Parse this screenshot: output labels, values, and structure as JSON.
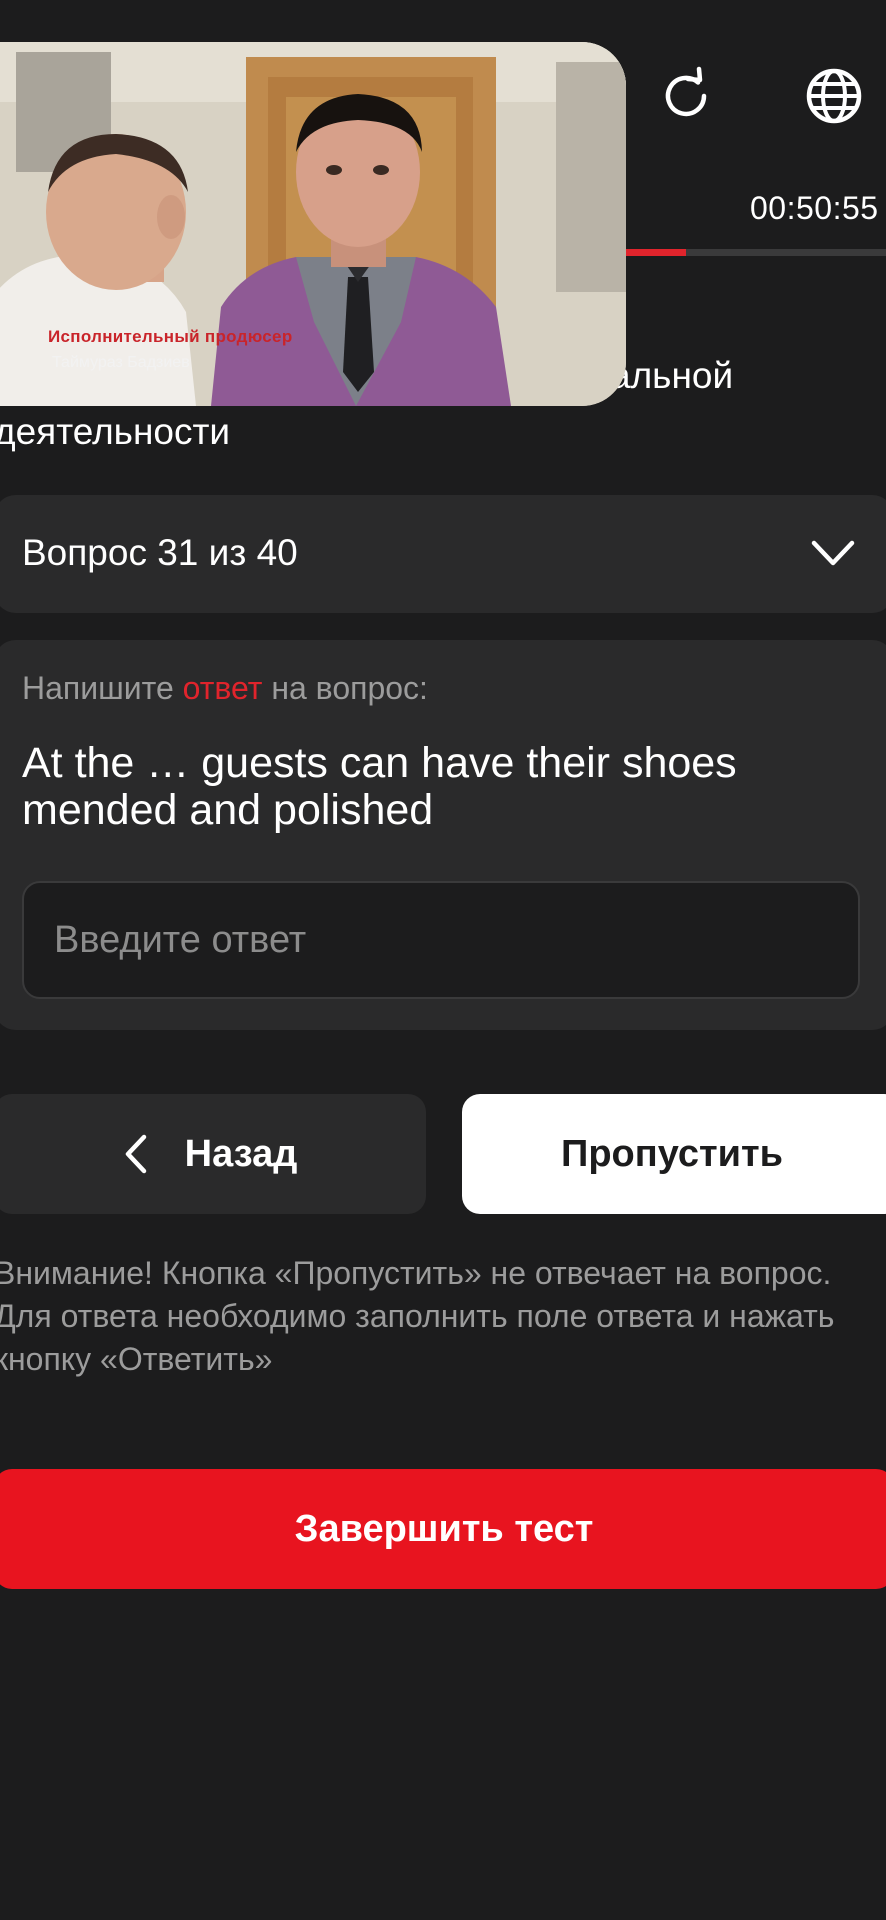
{
  "header": {
    "refresh_icon": "refresh-icon",
    "globe_icon": "globe-icon",
    "timer": "00:50:55",
    "progress_fraction": 0.774
  },
  "subject": {
    "title_line1": "альной",
    "title_line2": "деятельности"
  },
  "video": {
    "caption_role": "Исполнительный продюсер",
    "caption_name": "Таймураз Бадзиев"
  },
  "question_selector": {
    "label": "Вопрос 31 из 40",
    "chevron_icon": "chevron-down-icon"
  },
  "question": {
    "prompt_before": "Напишите ",
    "prompt_accent": "ответ",
    "prompt_after": " на вопрос:",
    "text": "At the … guests can have their shoes mended and polished",
    "input_placeholder": "Введите ответ",
    "input_value": ""
  },
  "actions": {
    "back_label": "Назад",
    "skip_label": "Пропустить",
    "warning": "Внимание! Кнопка «Пропустить» не отвечает на вопрос. Для ответа необходимо заполнить поле ответа и нажать кнопку «Ответить»",
    "finish_label": "Завершить тест"
  },
  "colors": {
    "background": "#1c1c1d",
    "card": "#2a2a2b",
    "accent": "#e0242c",
    "finish_button": "#e8141f"
  }
}
